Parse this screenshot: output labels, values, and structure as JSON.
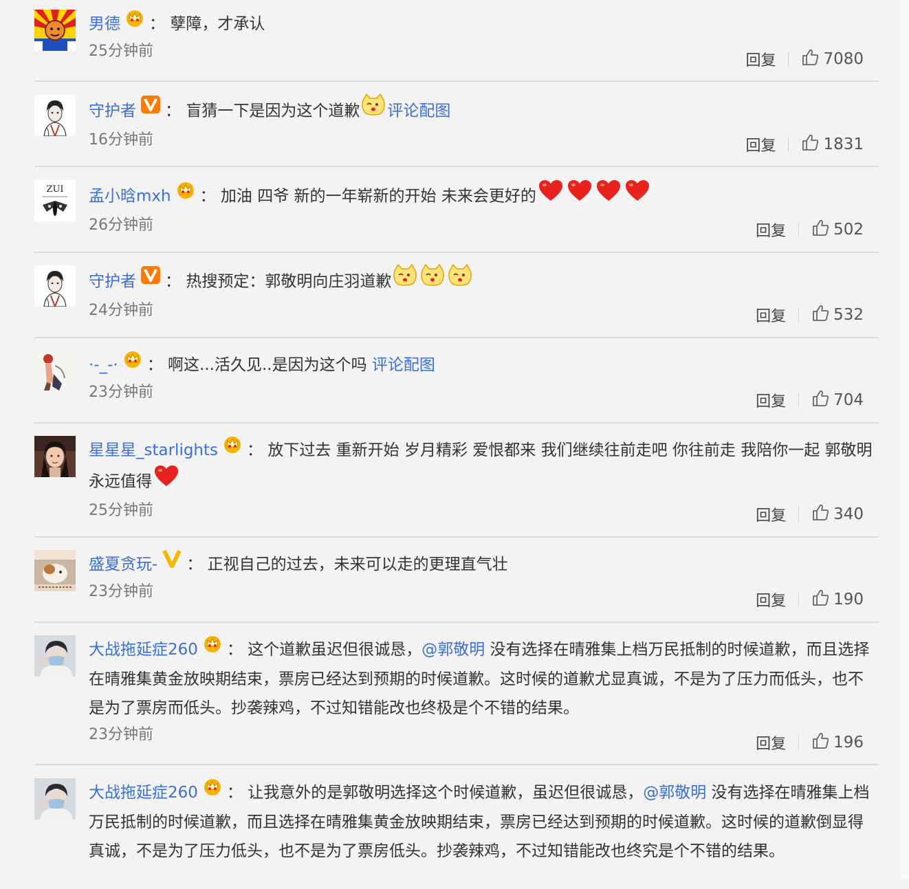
{
  "comments": [
    {
      "user": "男德",
      "badge": "crown",
      "segments": [
        {
          "t": "text",
          "v": "孽障，才承认"
        }
      ],
      "time": "25分钟前",
      "reply": "回复",
      "likes": "7080",
      "avatar": "flag-avatar"
    },
    {
      "user": "守护者",
      "badge": "v-red",
      "segments": [
        {
          "t": "text",
          "v": "盲猜一下是因为这个道歉"
        },
        {
          "t": "emoji",
          "v": "cat-emoji"
        },
        {
          "t": "link",
          "v": "评论配图"
        }
      ],
      "time": "16分钟前",
      "reply": "回复",
      "likes": "1831",
      "avatar": "sketch-avatar"
    },
    {
      "user": "孟小晗mxh",
      "badge": "crown",
      "segments": [
        {
          "t": "text",
          "v": "加油 四爷 新的一年崭新的开始 未来会更好的"
        },
        {
          "t": "emoji",
          "v": "heart-emoji"
        },
        {
          "t": "emoji",
          "v": "heart-emoji"
        },
        {
          "t": "emoji",
          "v": "heart-emoji"
        },
        {
          "t": "emoji",
          "v": "heart-emoji"
        }
      ],
      "time": "26分钟前",
      "reply": "回复",
      "likes": "502",
      "avatar": "zui-avatar",
      "avatar_text": "ZUI"
    },
    {
      "user": "守护者",
      "badge": "v-red",
      "segments": [
        {
          "t": "text",
          "v": "热搜预定：郭敬明向庄羽道歉"
        },
        {
          "t": "emoji",
          "v": "cat-emoji"
        },
        {
          "t": "emoji",
          "v": "cat-emoji"
        },
        {
          "t": "emoji",
          "v": "cat-emoji"
        }
      ],
      "time": "24分钟前",
      "reply": "回复",
      "likes": "532",
      "avatar": "sketch-avatar"
    },
    {
      "user": "·-_-·",
      "badge": "crown",
      "segments": [
        {
          "t": "text",
          "v": "啊这...活久见..是因为这个吗 "
        },
        {
          "t": "link",
          "v": "评论配图"
        }
      ],
      "time": "23分钟前",
      "reply": "回复",
      "likes": "704",
      "avatar": "illustration-avatar"
    },
    {
      "user": "星星星_starlights",
      "badge": "crown",
      "segments": [
        {
          "t": "text",
          "v": "放下过去 重新开始 岁月精彩 爱恨都来 我们继续往前走吧 你往前走 我陪你一起 郭敬明永远值得"
        },
        {
          "t": "emoji",
          "v": "heart-emoji"
        }
      ],
      "time": "25分钟前",
      "reply": "回复",
      "likes": "340",
      "avatar": "photo-girl-avatar"
    },
    {
      "user": "盛夏贪玩-",
      "badge": "v-yellow",
      "segments": [
        {
          "t": "text",
          "v": "正视自己的过去，未来可以走的更理直气壮"
        }
      ],
      "time": "23分钟前",
      "reply": "回复",
      "likes": "190",
      "avatar": "cat-photo-avatar"
    },
    {
      "user": "大战拖延症260",
      "badge": "crown",
      "segments": [
        {
          "t": "text",
          "v": "这个道歉虽迟但很诚恳，"
        },
        {
          "t": "link",
          "v": "@郭敬明"
        },
        {
          "t": "text",
          "v": " 没有选择在晴雅集上档万民抵制的时候道歉，而且选择在晴雅集黄金放映期结束，票房已经达到预期的时候道歉。这时候的道歉尤显真诚，不是为了压力而低头，也不是为了票房而低头。抄袭辣鸡，不过知错能改也终极是个不错的结果。"
        }
      ],
      "time": "23分钟前",
      "reply": "回复",
      "likes": "196",
      "avatar": "mask-avatar"
    },
    {
      "user": "大战拖延症260",
      "badge": "crown",
      "segments": [
        {
          "t": "text",
          "v": "让我意外的是郭敬明选择这个时候道歉，虽迟但很诚恳，"
        },
        {
          "t": "link",
          "v": "@郭敬明"
        },
        {
          "t": "text",
          "v": " 没有选择在晴雅集上档万民抵制的时候道歉，而且选择在晴雅集黄金放映期结束，票房已经达到预期的时候道歉。这时候的道歉倒显得真诚，不是为了压力低头，也不是为了票房低头。抄袭辣鸡，不过知错能改也终究是个不错的结果。"
        }
      ],
      "time": "",
      "reply": "",
      "likes": "",
      "avatar": "mask-avatar"
    }
  ],
  "colors": {
    "link": "#3b6fd8",
    "divider": "#dcdcdc",
    "background": "#f3f3f3",
    "heart": "#e8231f",
    "crown": "#f5b800"
  }
}
